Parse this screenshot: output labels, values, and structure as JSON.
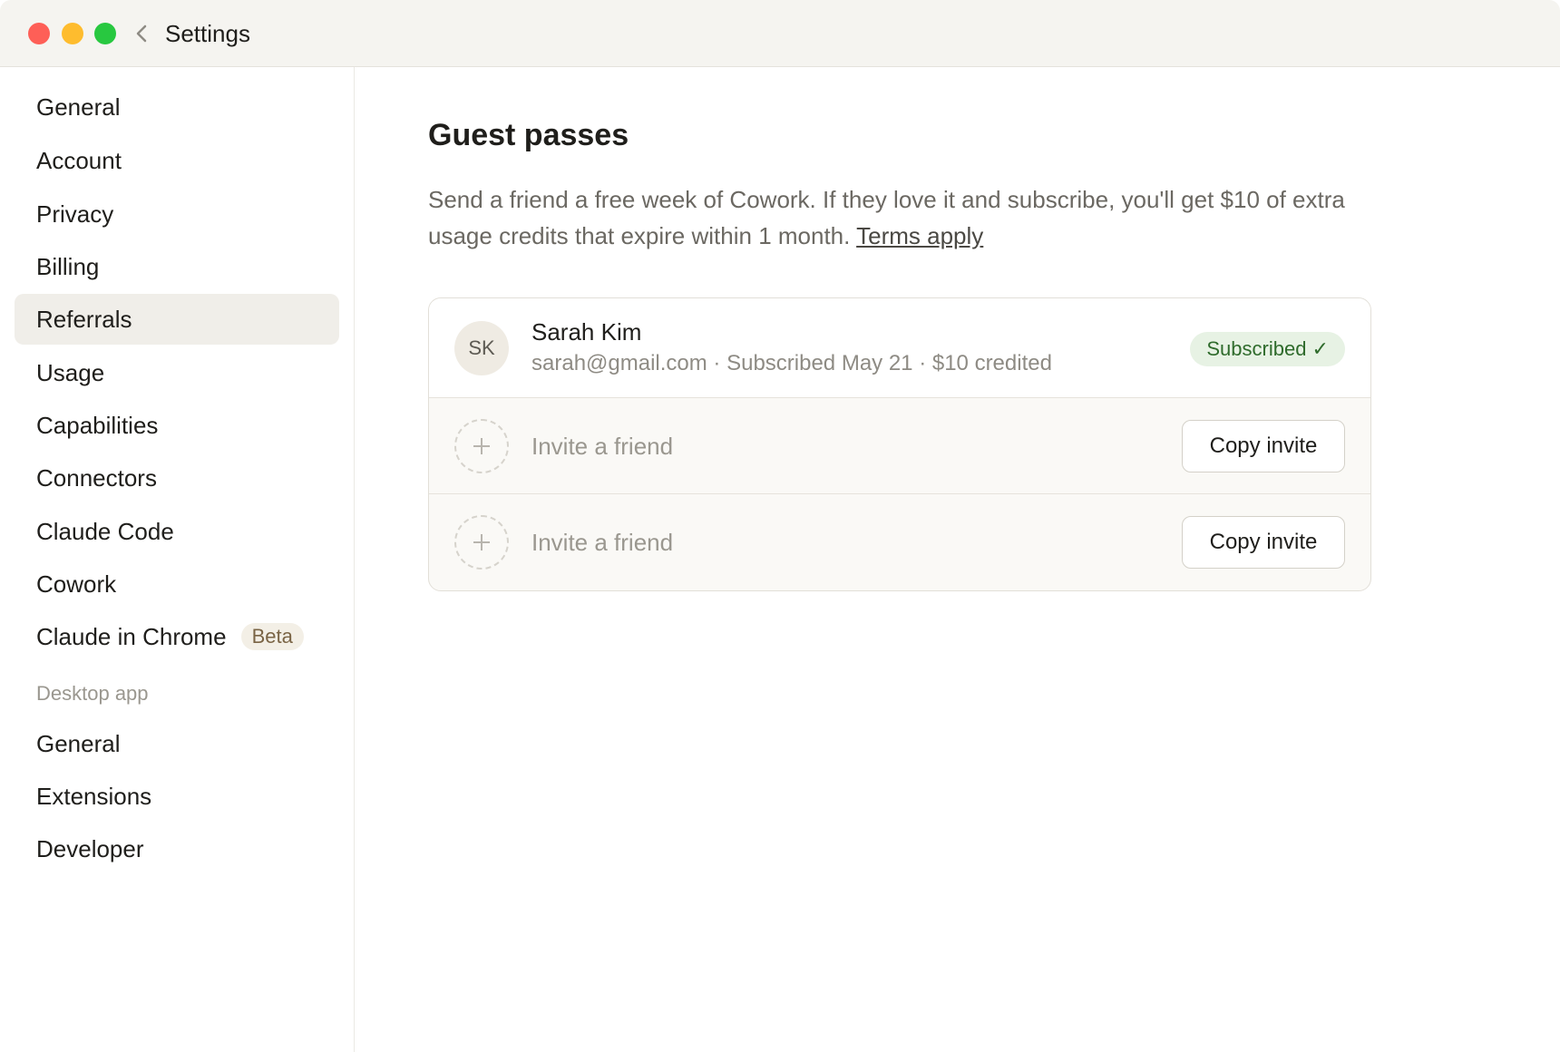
{
  "window": {
    "title": "Settings",
    "back_icon": "chevron-left-icon"
  },
  "sidebar": {
    "items": [
      {
        "label": "General"
      },
      {
        "label": "Account"
      },
      {
        "label": "Privacy"
      },
      {
        "label": "Billing"
      },
      {
        "label": "Referrals",
        "active": true
      },
      {
        "label": "Usage"
      },
      {
        "label": "Capabilities"
      },
      {
        "label": "Connectors"
      },
      {
        "label": "Claude Code"
      },
      {
        "label": "Cowork"
      },
      {
        "label": "Claude in Chrome",
        "badge": "Beta"
      }
    ],
    "section_label": "Desktop app",
    "desktop_items": [
      {
        "label": "General"
      },
      {
        "label": "Extensions"
      },
      {
        "label": "Developer"
      }
    ]
  },
  "main": {
    "title": "Guest passes",
    "description": "Send a friend a free week of Cowork. If they love it and subscribe, you'll get $10 of extra usage credits that expire within 1 month.",
    "terms_link": "Terms apply",
    "referral": {
      "initials": "SK",
      "name": "Sarah Kim",
      "meta": "sarah@gmail.com · Subscribed May 21 · $10 credited",
      "status": "Subscribed ✓"
    },
    "invites": [
      {
        "label": "Invite a friend",
        "button": "Copy invite"
      },
      {
        "label": "Invite a friend",
        "button": "Copy invite"
      }
    ]
  },
  "colors": {
    "accent_badge_bg": "#e7f2e4",
    "accent_badge_text": "#2f6b2c",
    "active_item_bg": "#f0eee9",
    "beta_badge_bg": "#f3efe6"
  }
}
